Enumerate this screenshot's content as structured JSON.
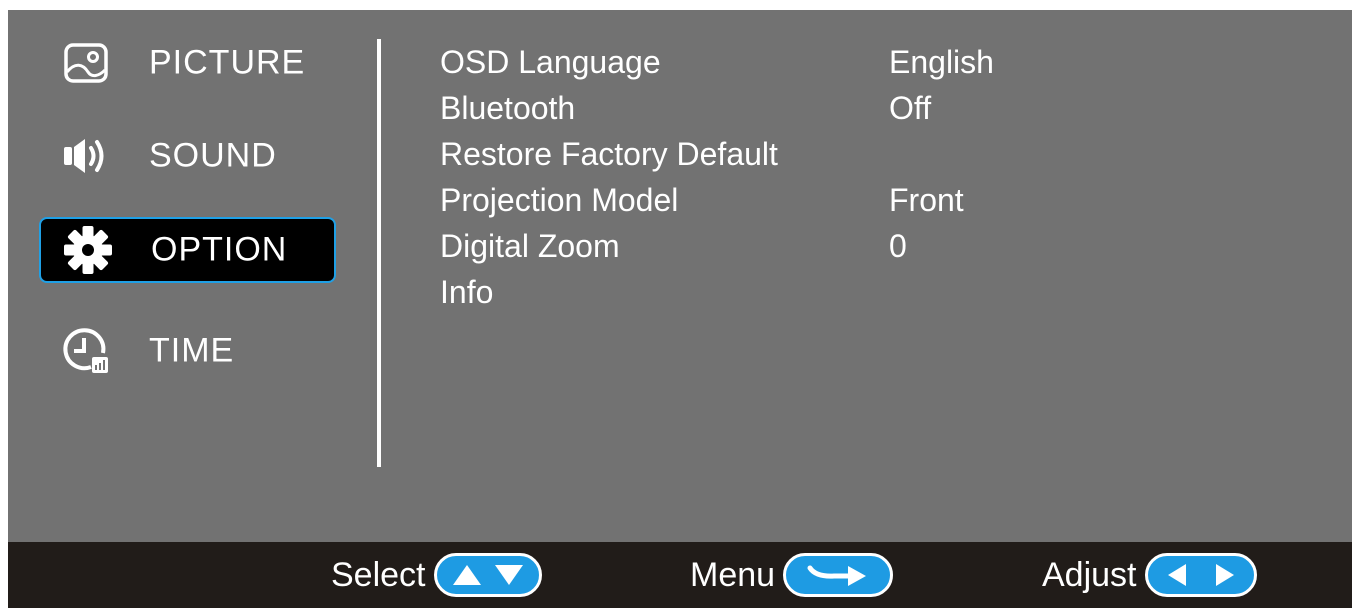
{
  "colors": {
    "panel_bg": "#727272",
    "footer_bg": "#211c19",
    "selected_bg": "#000000",
    "selected_border": "#1fa0e6",
    "accent_button": "#1e9be3",
    "text": "#ffffff"
  },
  "sidebar": {
    "items": [
      {
        "label": "PICTURE",
        "icon": "picture-icon",
        "selected": false
      },
      {
        "label": "SOUND",
        "icon": "speaker-icon",
        "selected": false
      },
      {
        "label": "OPTION",
        "icon": "gear-icon",
        "selected": true
      },
      {
        "label": "TIME",
        "icon": "clock-icon",
        "selected": false
      }
    ]
  },
  "menu": {
    "rows": [
      {
        "label": "OSD Language",
        "value": "English"
      },
      {
        "label": "Bluetooth",
        "value": "Off"
      },
      {
        "label": "Restore Factory Default",
        "value": ""
      },
      {
        "label": "Projection Model",
        "value": "Front"
      },
      {
        "label": "Digital Zoom",
        "value": "0"
      },
      {
        "label": "Info",
        "value": ""
      }
    ]
  },
  "footer": {
    "select_label": "Select",
    "select_icon": "up-down-arrows-icon",
    "menu_label": "Menu",
    "menu_icon": "return-arrow-icon",
    "adjust_label": "Adjust",
    "adjust_icon": "left-right-arrows-icon"
  }
}
